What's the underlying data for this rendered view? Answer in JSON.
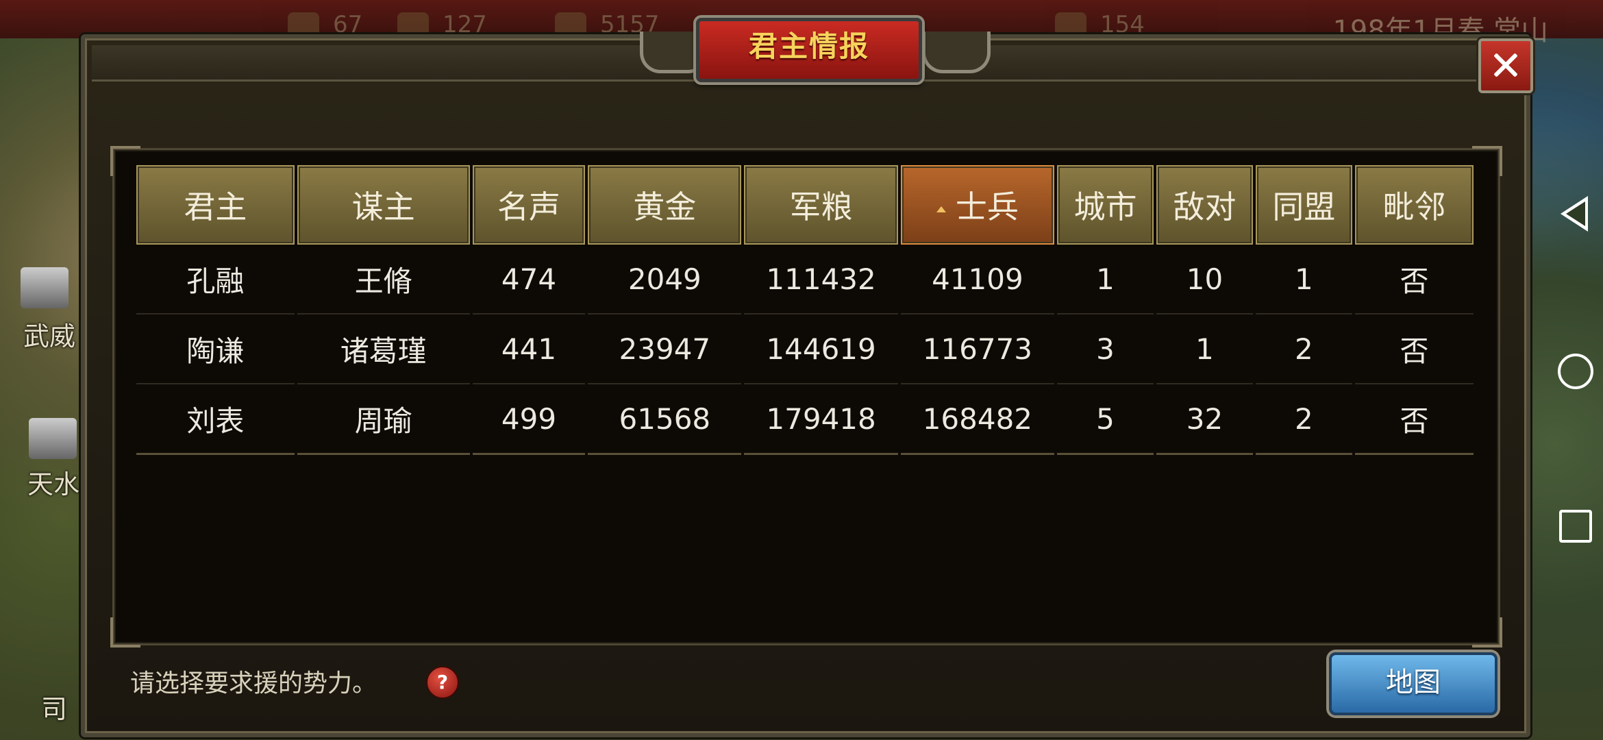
{
  "topbar": {
    "stats": [
      "67",
      "127",
      "5157",
      "154"
    ],
    "date": "198年1月春 常山"
  },
  "map_labels": [
    "武威",
    "天水",
    "司"
  ],
  "dialog": {
    "title": "君主情报",
    "columns": [
      "君主",
      "谋主",
      "名声",
      "黄金",
      "军粮",
      "士兵",
      "城市",
      "敌对",
      "同盟",
      "毗邻"
    ],
    "active_sort_column": "士兵",
    "rows": [
      [
        "孔融",
        "王脩",
        "474",
        "2049",
        "111432",
        "41109",
        "1",
        "10",
        "1",
        "否"
      ],
      [
        "陶谦",
        "诸葛瑾",
        "441",
        "23947",
        "144619",
        "116773",
        "3",
        "1",
        "2",
        "否"
      ],
      [
        "刘表",
        "周瑜",
        "499",
        "61568",
        "179418",
        "168482",
        "5",
        "32",
        "2",
        "否"
      ]
    ],
    "hint": "请选择要求援的势力。",
    "help_symbol": "?",
    "map_button": "地图"
  },
  "colors": {
    "title_red": "#c92b22",
    "header_gold": "#8a7a45",
    "active_orange": "#b8672b",
    "map_button_blue": "#2a6aa6"
  }
}
